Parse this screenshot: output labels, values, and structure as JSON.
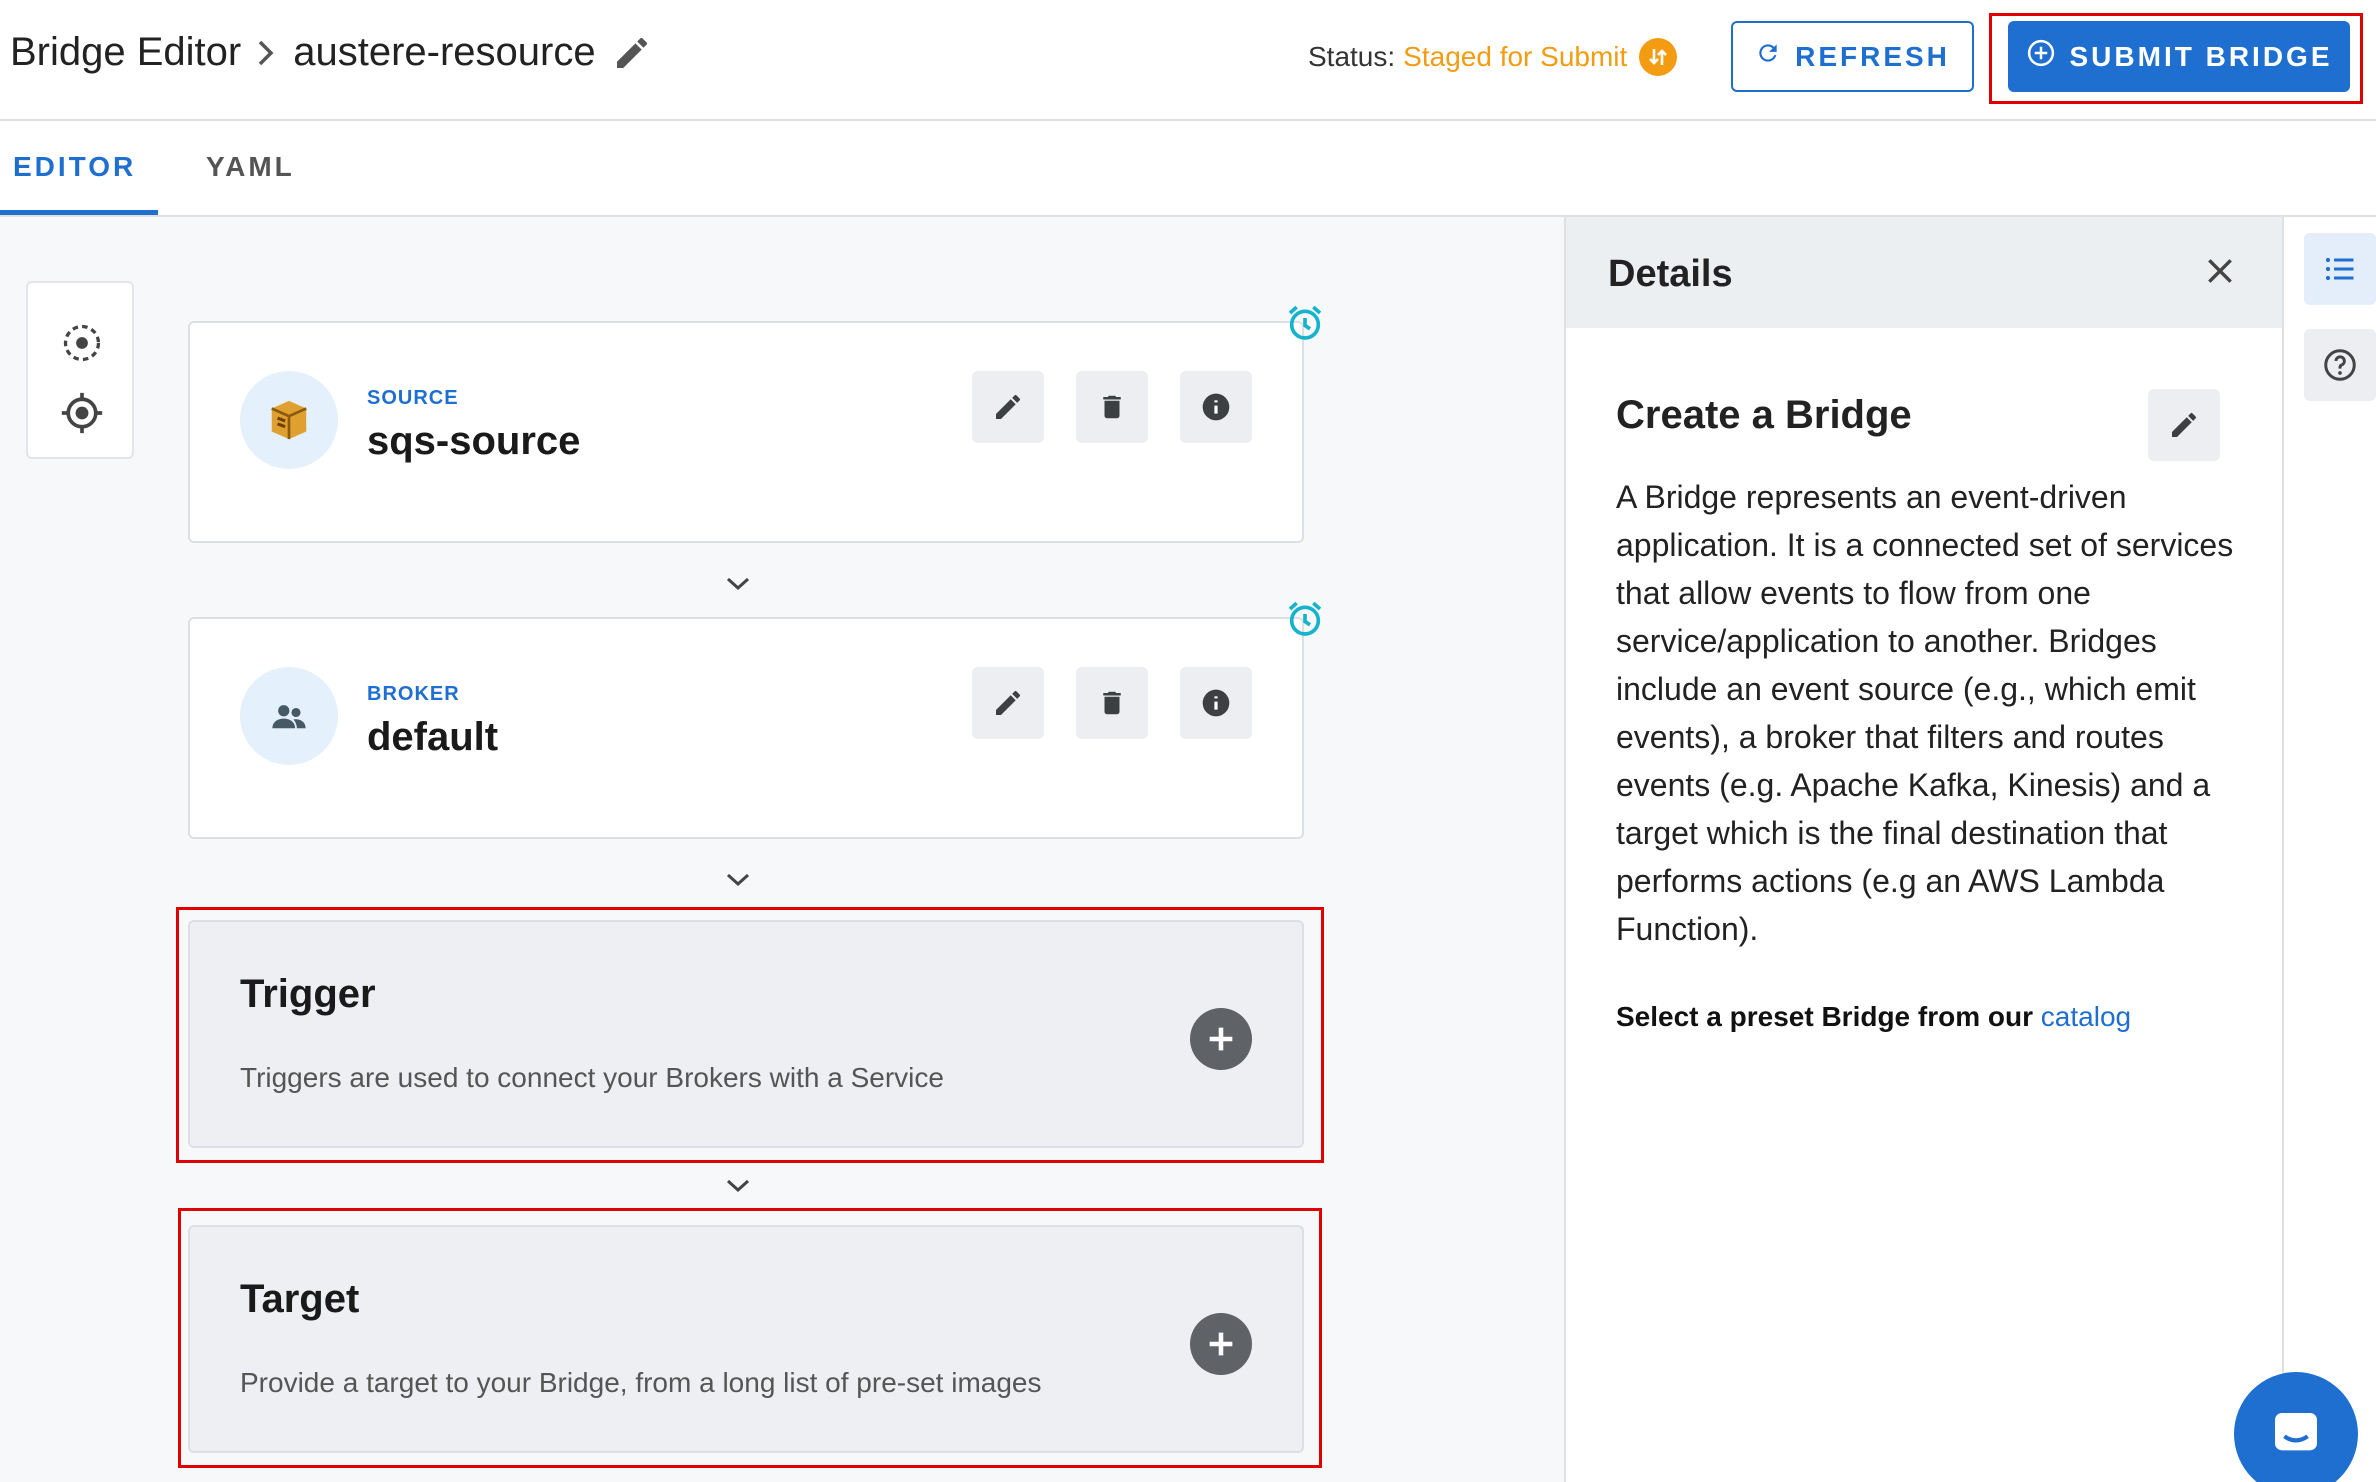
{
  "colors": {
    "primary": "#1e6fd0",
    "status_orange": "#f39c12",
    "cyan_alarm": "#16b3cc",
    "highlight_red": "#e00000",
    "icon_gray": "#5f6368"
  },
  "header": {
    "breadcrumb_root": "Bridge Editor",
    "breadcrumb_current": "austere-resource",
    "status_label": "Status:",
    "status_value": "Staged for Submit",
    "refresh_label": "REFRESH",
    "submit_label": "SUBMIT BRIDGE"
  },
  "tabs": [
    {
      "label": "EDITOR",
      "active": true
    },
    {
      "label": "YAML",
      "active": false
    }
  ],
  "canvas": {
    "zoom_tools": [
      "fit-view-icon",
      "center-target-icon"
    ],
    "source": {
      "kind": "SOURCE",
      "name": "sqs-source",
      "icon": "aws-sqs-icon"
    },
    "broker": {
      "kind": "BROKER",
      "name": "default",
      "icon": "people-icon"
    },
    "trigger": {
      "title": "Trigger",
      "description": "Triggers are used to connect your Brokers with a Service"
    },
    "target": {
      "title": "Target",
      "description": "Provide a target to your Bridge, from a long list of pre-set images"
    }
  },
  "details": {
    "title": "Details",
    "content_title": "Create a Bridge",
    "description": "A Bridge represents an event-driven application. It is a connected set of services that allow events to flow from one service/application to another. Bridges include an event source (e.g., which emit events), a broker that filters and routes events (e.g. Apache Kafka, Kinesis) and a target which is the final destination that performs actions (e.g an AWS Lambda Function).",
    "preset_text": "Select a preset Bridge from our",
    "preset_link": "catalog"
  }
}
